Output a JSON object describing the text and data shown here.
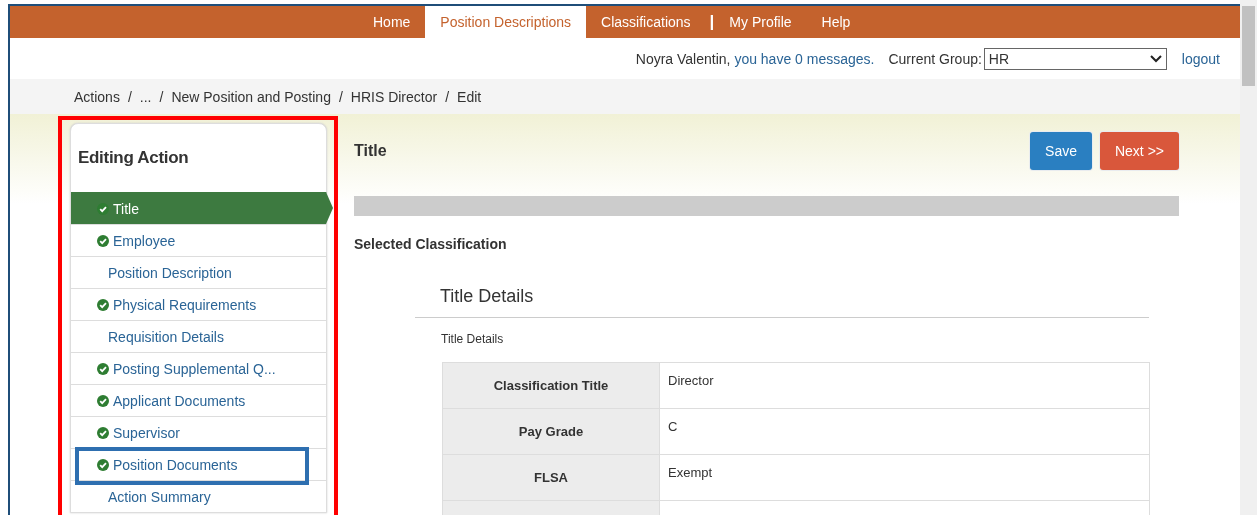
{
  "nav": [
    {
      "kind": "link",
      "label": "Home",
      "selected": false
    },
    {
      "kind": "link",
      "label": "Position Descriptions",
      "selected": true
    },
    {
      "kind": "link",
      "label": "Classifications",
      "selected": false
    },
    {
      "kind": "divider",
      "label": "|"
    },
    {
      "kind": "link",
      "label": "My Profile",
      "selected": false
    },
    {
      "kind": "link",
      "label": "Help",
      "selected": false
    }
  ],
  "user_bar": {
    "greeting": "Noyra Valentin,",
    "messages_link": "you have 0 messages.",
    "group_label": "Current Group:",
    "group_value": "HR",
    "logout": "logout"
  },
  "breadcrumb": [
    "Actions",
    "...",
    "New Position and Posting",
    "HRIS Director",
    "Edit"
  ],
  "breadcrumb_separator": "/",
  "sidebar": {
    "title": "Editing Action",
    "items": [
      {
        "label": "Title",
        "done": true,
        "selected": true
      },
      {
        "label": "Employee",
        "done": true,
        "selected": false
      },
      {
        "label": "Position Description",
        "done": false,
        "selected": false
      },
      {
        "label": "Physical Requirements",
        "done": true,
        "selected": false
      },
      {
        "label": "Requisition Details",
        "done": false,
        "selected": false
      },
      {
        "label": "Posting Supplemental Q...",
        "done": true,
        "selected": false
      },
      {
        "label": "Applicant Documents",
        "done": true,
        "selected": false
      },
      {
        "label": "Supervisor",
        "done": true,
        "selected": false
      },
      {
        "label": "Position Documents",
        "done": true,
        "selected": false
      },
      {
        "label": "Action Summary",
        "done": false,
        "selected": false
      }
    ]
  },
  "main": {
    "title": "Title",
    "buttons": [
      {
        "kind": "primary",
        "label": "Save"
      },
      {
        "kind": "danger",
        "label": "Next >>"
      }
    ],
    "section_title": "Selected Classification",
    "card": {
      "title": "Title Details",
      "subtitle": "Title Details",
      "rows": [
        {
          "label": "Classification Title",
          "value": "Director"
        },
        {
          "label": "Pay Grade",
          "value": "C"
        },
        {
          "label": "FLSA",
          "value": "Exempt"
        }
      ]
    }
  },
  "highlights": [
    {
      "kind": "panel",
      "color": "#ff0000"
    },
    {
      "kind": "item",
      "color": "#2e6fb0"
    }
  ]
}
